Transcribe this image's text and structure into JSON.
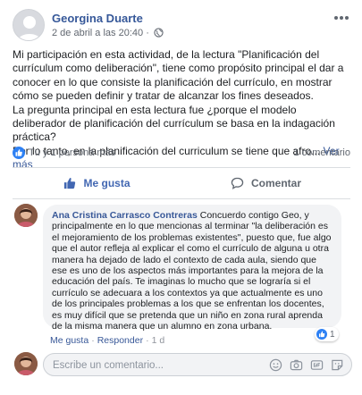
{
  "post": {
    "author": "Georgina Duarte",
    "timestamp": "2 de abril a las 20:40",
    "meta_separator": "·",
    "text_lines": [
      "Mi participación en esta actividad, de la lectura \"Planificación del currículum como deliberación\", tiene como propósito principal el dar a conocer en lo que consiste la planificación del currículo, en mostrar cómo se pueden definir y tratar de alcanzar los fines deseados.",
      "La pregunta principal en esta lectura fue ¿porque el modelo deliberador de planificación del currículum se basa en la indagación práctica?",
      "Por lo tanto, en la planificación del curriculum se tiene que afro..."
    ],
    "see_more": "Ver más"
  },
  "reactions": {
    "summary": "Tú y 1 persona más",
    "comment_count": "1 comentario"
  },
  "actions": {
    "like": "Me gusta",
    "comment": "Comentar"
  },
  "comment": {
    "author": "Ana Cristina Carrasco Contreras",
    "text": "Concuerdo contigo Geo, y principalmente en lo que mencionas al terminar \"la deliberación es el mejoramiento de los problemas existentes\", puesto que, fue algo que el autor refleja al explicar el como el currículo de alguna u otra manera ha dejado de lado el contexto de cada aula, siendo que ese es uno de los aspectos más importantes para la mejora de la educación del país. Te imaginas lo mucho que se lograría si el currículo se adecuara a los contextos ya que actualmente es uno de los principales problemas a los que se enfrentan los docentes, es muy difícil que se pretenda que un niño en zona rural aprenda de la misma manera que un alumno en zona urbana.",
    "reaction_count": "1",
    "like_label": "Me gusta",
    "reply_label": "Responder",
    "time": "1 d",
    "separator": "·"
  },
  "reply_box": {
    "placeholder": "Escribe un comentario..."
  },
  "colors": {
    "link_blue": "#385898",
    "like_blue": "#2e81f4",
    "bubble_bg": "#f2f3f5"
  }
}
